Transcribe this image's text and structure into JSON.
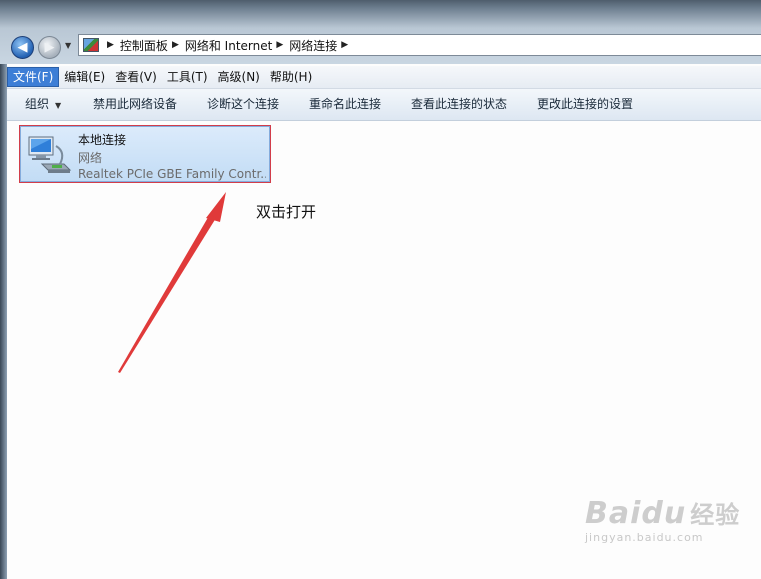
{
  "address_bar": {
    "breadcrumbs": [
      "控制面板",
      "网络和 Internet",
      "网络连接"
    ]
  },
  "menu": {
    "items": [
      "文件(F)",
      "编辑(E)",
      "查看(V)",
      "工具(T)",
      "高级(N)",
      "帮助(H)"
    ],
    "active_index": 0
  },
  "toolbar": {
    "organize": "组织",
    "disable": "禁用此网络设备",
    "diagnose": "诊断这个连接",
    "rename": "重命名此连接",
    "view_status": "查看此连接的状态",
    "change_settings": "更改此连接的设置"
  },
  "connection": {
    "name": "本地连接",
    "type": "网络",
    "device": "Realtek PCIe GBE Family Contr..."
  },
  "annotation": {
    "text": "双击打开",
    "color": "#e03a3a"
  },
  "watermark": {
    "logo": "Baidu 经验",
    "url": "jingyan.baidu.com"
  }
}
